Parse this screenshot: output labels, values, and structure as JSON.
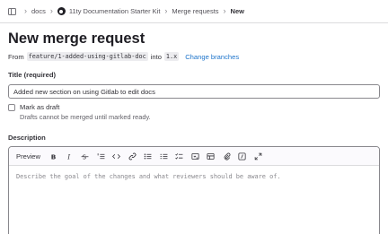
{
  "breadcrumb": {
    "items": [
      "docs",
      "11ty Documentation Starter Kit",
      "Merge requests",
      "New"
    ]
  },
  "page": {
    "title": "New merge request"
  },
  "branches": {
    "from_label": "From",
    "source": "feature/1-added-using-gitlab-doc",
    "into_label": "into",
    "target": "1.x",
    "change_link": "Change branches"
  },
  "form": {
    "title_label": "Title (required)",
    "title_value": "Added new section on using Gitlab to edit docs",
    "draft_label": "Mark as draft",
    "draft_help": "Drafts cannot be merged until marked ready.",
    "draft_checked": false,
    "description_label": "Description"
  },
  "editor": {
    "preview_label": "Preview",
    "toolbar_icons": [
      "bold-icon",
      "italic-icon",
      "strikethrough-icon",
      "numbered-list-icon",
      "code-icon",
      "link-icon",
      "bullet-list-icon",
      "ordered-list-icon",
      "task-list-icon",
      "collapsible-icon",
      "table-icon",
      "attach-file-icon",
      "quick-actions-icon",
      "fullscreen-icon"
    ],
    "placeholder": "Describe the goal of the changes and what reviewers should be aware of."
  },
  "colors": {
    "link": "#1f75cb",
    "text": "#333238",
    "border": "#89888d",
    "muted": "#626168"
  }
}
